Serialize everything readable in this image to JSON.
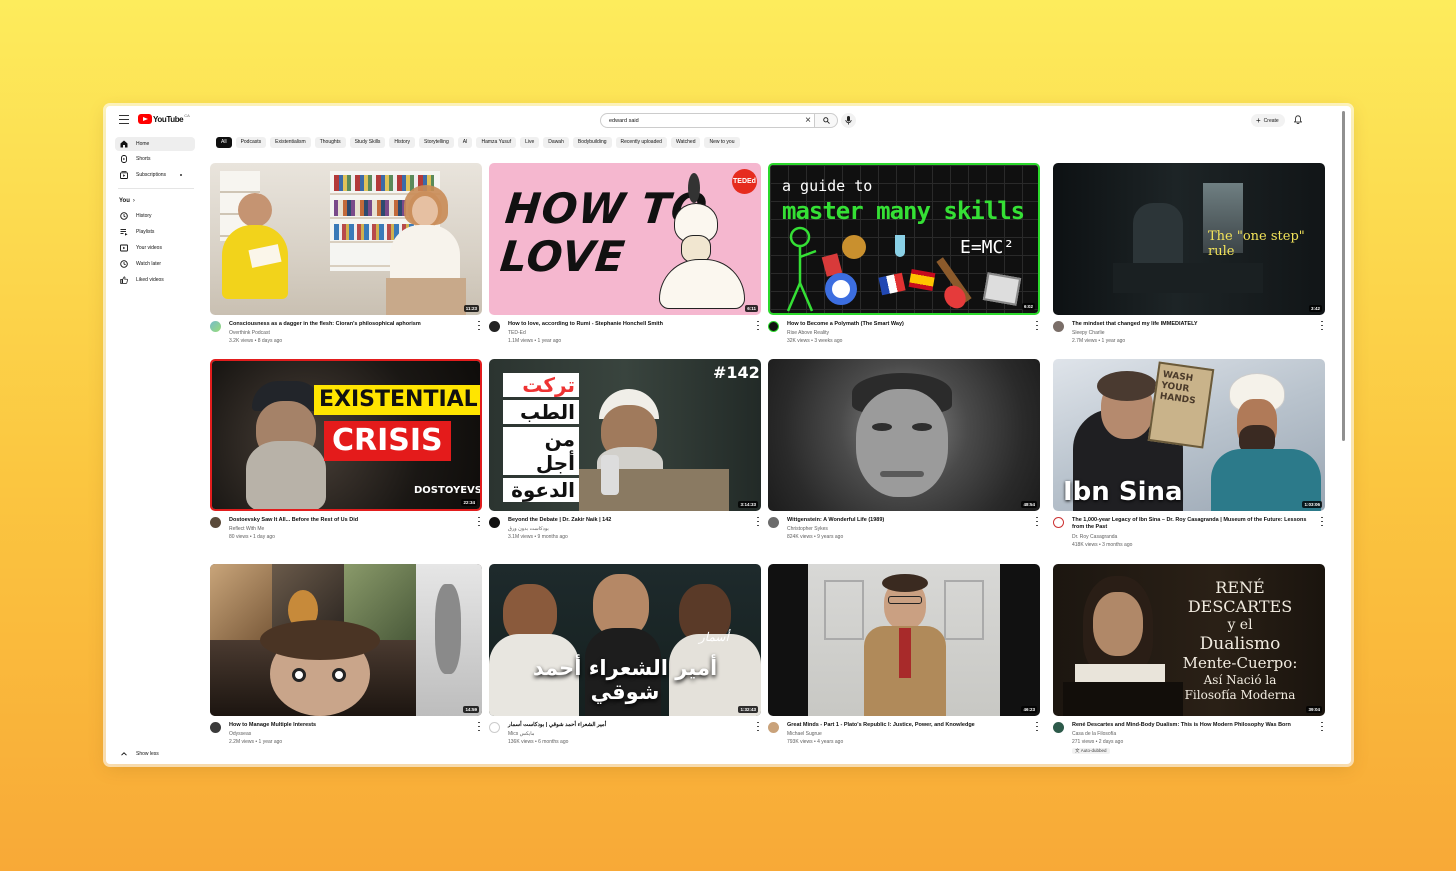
{
  "app": {
    "logo_text": "YouTube",
    "logo_region": "CA"
  },
  "search": {
    "value": "edward said",
    "placeholder": "Search"
  },
  "header": {
    "create_label": "Create"
  },
  "sidebar": {
    "main": [
      {
        "label": "Home",
        "icon": "home-icon",
        "active": true
      },
      {
        "label": "Shorts",
        "icon": "shorts-icon"
      },
      {
        "label": "Subscriptions",
        "icon": "subscriptions-icon"
      }
    ],
    "you_heading": "You",
    "you": [
      {
        "label": "History",
        "icon": "history-icon"
      },
      {
        "label": "Playlists",
        "icon": "playlists-icon"
      },
      {
        "label": "Your videos",
        "icon": "your-videos-icon"
      },
      {
        "label": "Watch later",
        "icon": "watch-later-icon"
      },
      {
        "label": "Liked videos",
        "icon": "liked-videos-icon"
      }
    ],
    "show_less": "Show less"
  },
  "chips": [
    "All",
    "Podcasts",
    "Existentialism",
    "Thoughts",
    "Study Skills",
    "History",
    "Storytelling",
    "AI",
    "Hamza Yusuf",
    "Live",
    "Dawah",
    "Bodybuilding",
    "Recently uploaded",
    "Watched",
    "New to you"
  ],
  "videos": [
    {
      "title": "Consciousness as a dagger in the flesh: Cioran's philosophical aphorism",
      "channel": "Overthink Podcast",
      "meta": "3.2K views • 8 days ago",
      "duration": "11:23"
    },
    {
      "title": "How to love, according to Rumi - Stephanie Honchell Smith",
      "channel": "TED-Ed",
      "meta": "1.1M views • 1 year ago",
      "duration": "6:11",
      "thumb_text": [
        "HOW TO",
        "LOVE"
      ],
      "badge": "TEDEd"
    },
    {
      "title": "How to Become a Polymath (The Smart Way)",
      "channel": "Rise Above Reality",
      "meta": "32K views • 3 weeks ago",
      "duration": "6:02",
      "thumb_text": [
        "a guide to",
        "master many skills",
        "E=MC²"
      ]
    },
    {
      "title": "The mindset that changed my life IMMEDIATELY",
      "channel": "Sleepy Charlie",
      "meta": "2.7M views • 1 year ago",
      "duration": "3:42",
      "thumb_text": [
        "The \"one step\" rule"
      ]
    },
    {
      "title": "Dostoevsky Saw It All... Before the Rest of Us Did",
      "channel": "Reflect With Me",
      "meta": "80 views • 1 day ago",
      "duration": "22:34",
      "thumb_text": [
        "EXISTENTIAL",
        "CRISIS",
        "DOSTOYEVSKI"
      ]
    },
    {
      "title": "Beyond the Debate | Dr. Zakir Naik | 142",
      "channel": "بودكاست بدون ورق",
      "meta": "3.1M views • 9 months ago",
      "duration": "3:14:33",
      "thumb_text": [
        "تركت",
        "الطب",
        "من أجل",
        "الدعوة",
        "#142"
      ]
    },
    {
      "title": "Wittgenstein: A Wonderful Life (1989)",
      "channel": "Christopher Sykes",
      "meta": "824K views • 9 years ago",
      "duration": "48:54"
    },
    {
      "title": "The 1,000-year Legacy of Ibn Sina – Dr. Roy Casagranda | Museum of the Future: Lessons from the Past",
      "channel": "Dr. Roy Casagranda",
      "meta": "418K views • 3 months ago",
      "duration": "1:03:06",
      "thumb_text": [
        "Ibn Sina",
        "WASH YOUR HANDS"
      ]
    },
    {
      "title": "How to Manage Multiple Interests",
      "channel": "Odysseas",
      "meta": "2.2M views • 1 year ago",
      "duration": "14:59"
    },
    {
      "title": "أمير الشعراء أحمد شوقي | بودكاست أسمار",
      "channel": "Mics مايكس",
      "meta": "136K views • 6 months ago",
      "duration": "1:32:43",
      "thumb_text": [
        "أمير الشعراء أحمد شوقي",
        "أسمار"
      ]
    },
    {
      "title": "Great Minds - Part 1 - Plato's Republic I: Justice, Power, and Knowledge",
      "channel": "Michael Sugrue",
      "meta": "793K views • 4 years ago",
      "duration": "46:23"
    },
    {
      "title": "René Descartes and Mind-Body Dualism: This is How Modern Philosophy Was Born",
      "channel": "Casa de la Filosofía",
      "meta": "271 views • 2 days ago",
      "duration": "39:04",
      "badge": "Auto-dubbed",
      "thumb_text": [
        "RENÉ",
        "DESCARTES",
        "y el",
        "Dualismo",
        "Mente-Cuerpo:",
        "Así Nació la",
        "Filosofía Moderna"
      ]
    }
  ]
}
